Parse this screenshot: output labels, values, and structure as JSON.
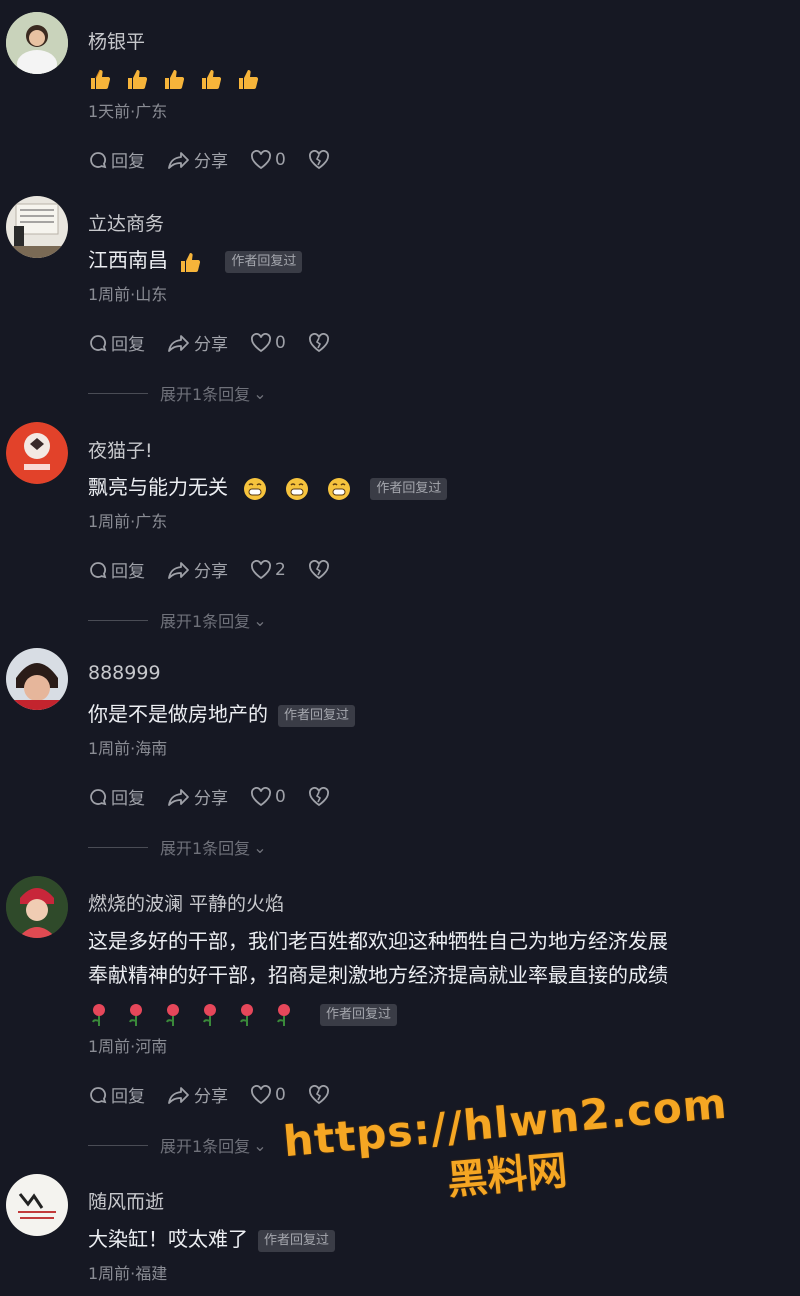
{
  "comments": [
    {
      "username": "杨银平",
      "text": "",
      "meta": "1天前·广东",
      "likes": "0",
      "badge": "",
      "expand": ""
    },
    {
      "username": "立达商务",
      "text": "江西南昌",
      "meta": "1周前·山东",
      "likes": "0",
      "badge": "作者回复过",
      "expand": "展开1条回复"
    },
    {
      "username": "夜猫子!",
      "text": "飘亮与能力无关",
      "meta": "1周前·广东",
      "likes": "2",
      "badge": "作者回复过",
      "expand": "展开1条回复"
    },
    {
      "username": "888999",
      "text": "你是不是做房地产的",
      "meta": "1周前·海南",
      "likes": "0",
      "badge": "作者回复过",
      "expand": "展开1条回复"
    },
    {
      "username": "燃烧的波澜 平静的火焰",
      "text": "这是多好的干部，我们老百姓都欢迎这种牺牲自己为地方经济发展",
      "text2": "奉献精神的好干部，招商是刺激地方经济提高就业率最直接的成绩",
      "meta": "1周前·河南",
      "likes": "0",
      "badge": "作者回复过",
      "expand": "展开1条回复"
    },
    {
      "username": "随风而逝",
      "text": "大染缸！哎太难了",
      "meta": "1周前·福建",
      "badge": "作者回复过"
    }
  ],
  "actions": {
    "reply": "回复",
    "share": "分享"
  },
  "watermark": {
    "url": "https://hlwn2.com",
    "name": "黑料网"
  },
  "icons": {
    "reply": "reply-bubble-icon",
    "share": "share-arrow-icon",
    "like": "heart-icon",
    "dislike": "broken-heart-icon",
    "emoji_thumb": "thumbs-up-emoji",
    "emoji_grin": "grin-emoji",
    "emoji_rose": "rose-emoji"
  }
}
